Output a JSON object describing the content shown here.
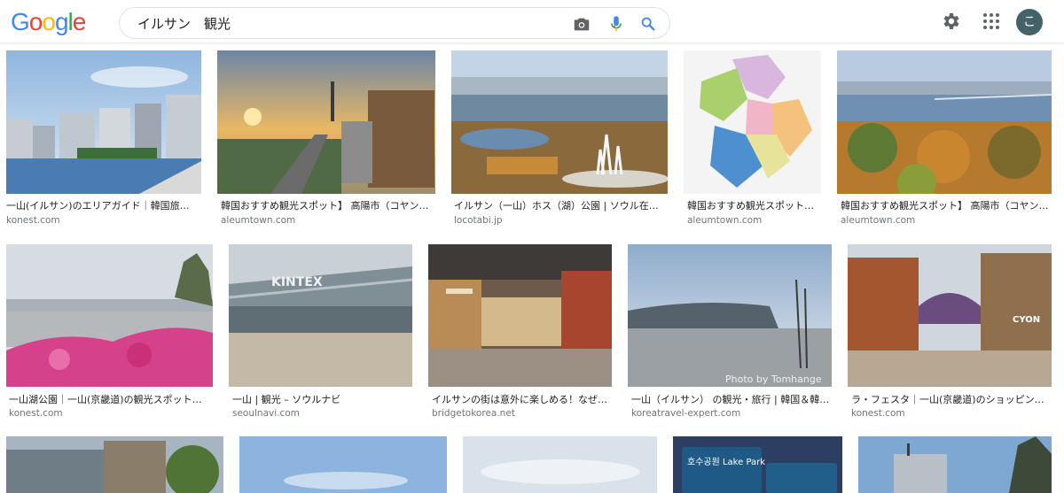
{
  "header": {
    "logo_letters": [
      "G",
      "o",
      "o",
      "g",
      "l",
      "e"
    ],
    "search_value": "イルサン　観光",
    "avatar_letter": "こ",
    "icons": [
      "camera-icon",
      "microphone-icon",
      "search-icon",
      "gear-icon",
      "apps-grid-icon"
    ]
  },
  "results": [
    {
      "caption": "一山(イルサン)のエリアガイド｜韓国旅…",
      "domain": "konest.com"
    },
    {
      "caption": "韓国おすすめ観光スポット】 高陽市（コヤン…",
      "domain": "aleumtown.com"
    },
    {
      "caption": "イルサン（一山）ホス（湖）公園 | ソウル在住…",
      "domain": "locotabi.jp"
    },
    {
      "caption": "韓国おすすめ観光スポット…",
      "domain": "aleumtown.com"
    },
    {
      "caption": "韓国おすすめ観光スポット】 高陽市（コヤン…",
      "domain": "aleumtown.com"
    },
    {
      "caption": "一山湖公園｜一山(京畿道)の観光スポット｜…",
      "domain": "konest.com"
    },
    {
      "caption": "一山 | 観光 – ソウルナビ",
      "domain": "seoulnavi.com"
    },
    {
      "caption": "イルサンの街は意外に楽しめる！なぜ…",
      "domain": "bridgetokorea.net"
    },
    {
      "caption": "一山（イルサン） の観光・旅行 | 韓国＆韓…",
      "domain": "koreatravel-expert.com"
    },
    {
      "caption": "ラ・フェスタ｜一山(京畿道)のショッピン…",
      "domain": "konest.com"
    }
  ],
  "image_texts": {
    "kintex_sign": "KINTEX",
    "photo_credit": "Photo by Tomhange",
    "sign_text": "호수공원 Lake Park",
    "cyon": "CYON"
  }
}
